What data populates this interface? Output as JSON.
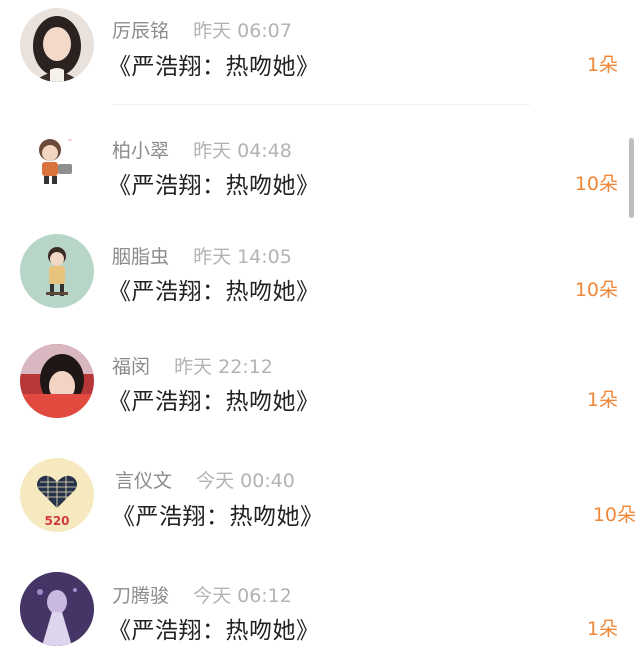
{
  "items": [
    {
      "name": "厉辰铭",
      "time": "昨天 06:07",
      "message": "《严浩翔：热吻她》",
      "count": "1朵"
    },
    {
      "name": "柏小翠",
      "time": "昨天 04:48",
      "message": "《严浩翔：热吻她》",
      "count": "10朵"
    },
    {
      "name": "胭脂虫",
      "time": "昨天 14:05",
      "message": "《严浩翔：热吻她》",
      "count": "10朵"
    },
    {
      "name": "福闵",
      "time": "昨天 22:12",
      "message": "《严浩翔：热吻她》",
      "count": "1朵"
    },
    {
      "name": "言仪文",
      "time": "今天 00:40",
      "message": "《严浩翔：热吻她》",
      "count": "10朵"
    },
    {
      "name": "刀腾骏",
      "time": "今天 06:12",
      "message": "《严浩翔：热吻她》",
      "count": "1朵"
    }
  ],
  "avatar_5_text": "520",
  "colors": {
    "accent": "#f0883a",
    "name_text": "#8c8c8c",
    "time_text": "#b3b3b3",
    "message_text": "#222222"
  },
  "icons": [
    "user-avatar",
    "heart-avatar"
  ]
}
